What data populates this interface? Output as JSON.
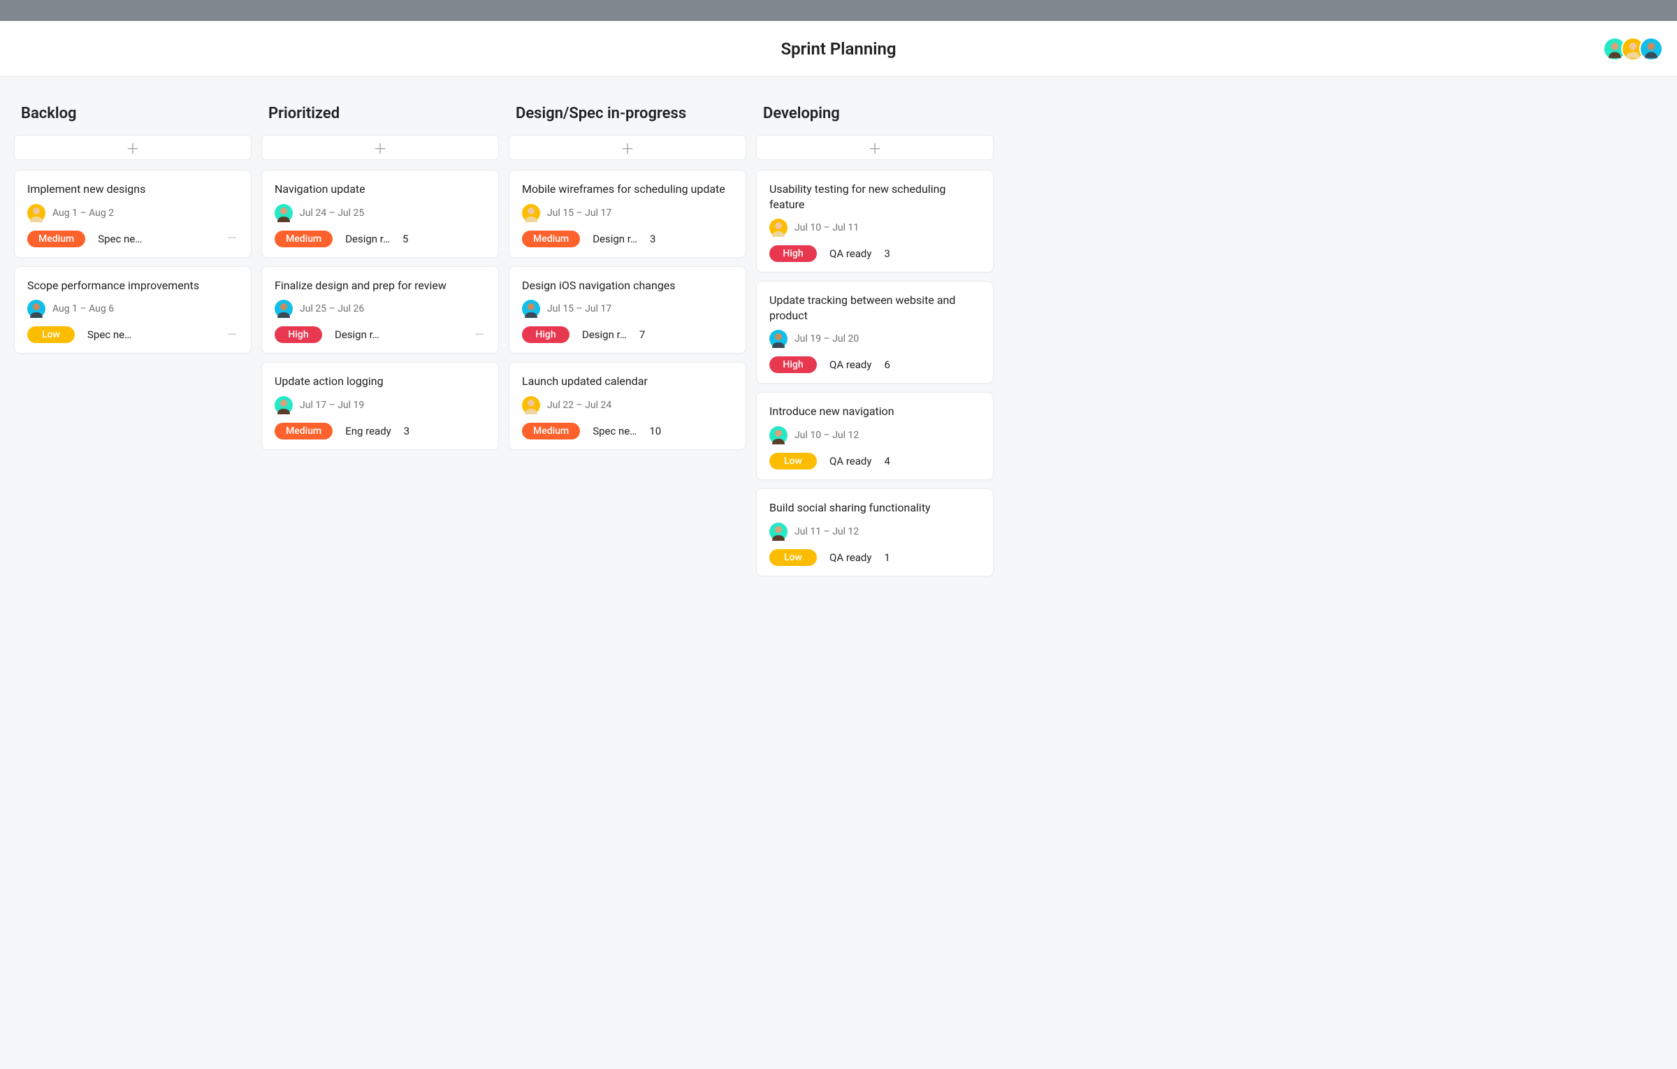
{
  "header": {
    "title": "Sprint Planning"
  },
  "priority_labels": {
    "medium": "Medium",
    "high": "High",
    "low": "Low"
  },
  "columns": [
    {
      "title": "Backlog",
      "cards": [
        {
          "title": "Implement new designs",
          "assignee": "yellow",
          "date": "Aug 1 – Aug 2",
          "priority": "medium",
          "status": "Spec ne…",
          "count": null,
          "trailing_dash": true
        },
        {
          "title": "Scope performance improvements",
          "assignee": "cyan",
          "date": "Aug 1 – Aug 6",
          "priority": "low",
          "status": "Spec ne…",
          "count": null,
          "trailing_dash": true
        }
      ]
    },
    {
      "title": "Prioritized",
      "cards": [
        {
          "title": "Navigation update",
          "assignee": "green",
          "date": "Jul 24 – Jul 25",
          "priority": "medium",
          "status": "Design r…",
          "count": "5",
          "trailing_dash": false
        },
        {
          "title": "Finalize design and prep for review",
          "assignee": "cyan",
          "date": "Jul 25 – Jul 26",
          "priority": "high",
          "status": "Design r…",
          "count": null,
          "trailing_dash": true
        },
        {
          "title": "Update action logging",
          "assignee": "green",
          "date": "Jul 17 – Jul 19",
          "priority": "medium",
          "status": "Eng ready",
          "count": "3",
          "trailing_dash": false
        }
      ]
    },
    {
      "title": "Design/Spec in-progress",
      "cards": [
        {
          "title": "Mobile wireframes for scheduling update",
          "assignee": "yellow",
          "date": "Jul 15 – Jul 17",
          "priority": "medium",
          "status": "Design r…",
          "count": "3",
          "trailing_dash": false
        },
        {
          "title": "Design iOS navigation changes",
          "assignee": "cyan",
          "date": "Jul 15 – Jul 17",
          "priority": "high",
          "status": "Design r…",
          "count": "7",
          "trailing_dash": false
        },
        {
          "title": "Launch updated calendar",
          "assignee": "yellow",
          "date": "Jul 22 – Jul 24",
          "priority": "medium",
          "status": "Spec ne…",
          "count": "10",
          "trailing_dash": false
        }
      ]
    },
    {
      "title": "Developing",
      "cards": [
        {
          "title": "Usability testing for new scheduling feature",
          "assignee": "yellow",
          "date": "Jul 10 – Jul 11",
          "priority": "high",
          "status": "QA ready",
          "count": "3",
          "trailing_dash": false
        },
        {
          "title": "Update tracking between website and product",
          "assignee": "cyan",
          "date": "Jul 19 – Jul 20",
          "priority": "high",
          "status": "QA ready",
          "count": "6",
          "trailing_dash": false
        },
        {
          "title": "Introduce new navigation",
          "assignee": "green",
          "date": "Jul 10 – Jul 12",
          "priority": "low",
          "status": "QA ready",
          "count": "4",
          "trailing_dash": false
        },
        {
          "title": "Build social sharing functionality",
          "assignee": "green",
          "date": "Jul 11 – Jul 12",
          "priority": "low",
          "status": "QA ready",
          "count": "1",
          "trailing_dash": false
        }
      ]
    }
  ]
}
